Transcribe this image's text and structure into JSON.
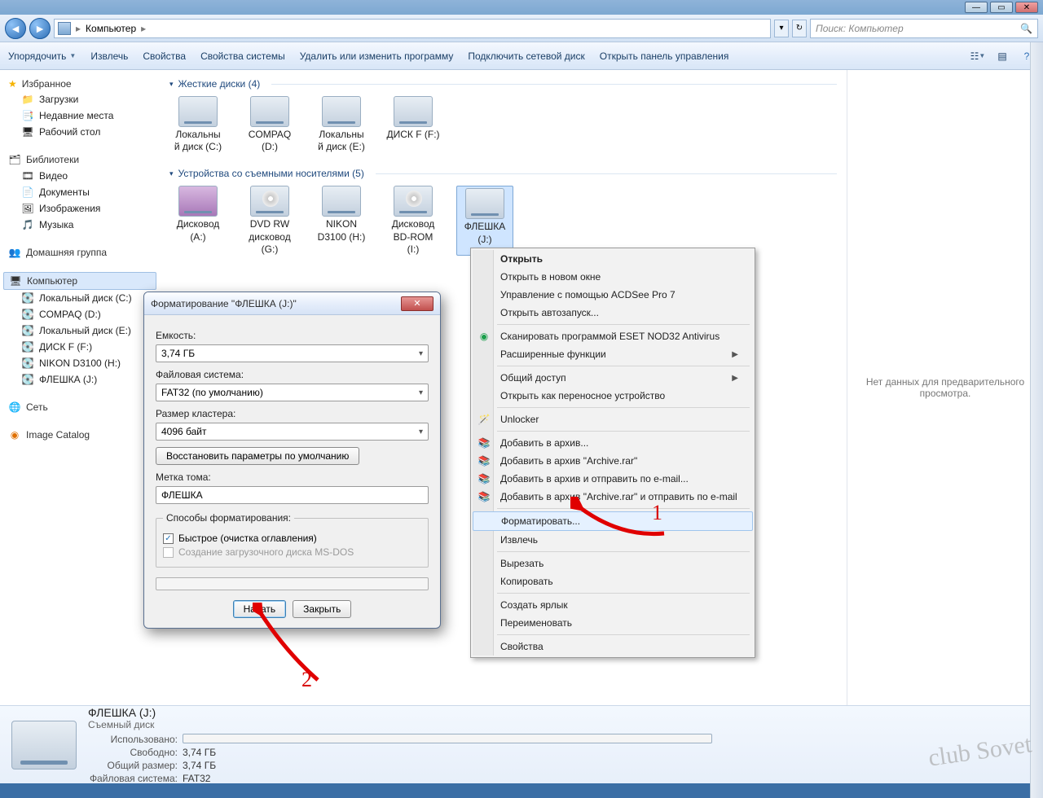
{
  "breadcrumb": {
    "root": "Компьютер",
    "search_placeholder": "Поиск: Компьютер"
  },
  "toolbar": {
    "organize": "Упорядочить",
    "extract": "Извлечь",
    "properties": "Свойства",
    "system_properties": "Свойства системы",
    "remove_change": "Удалить или изменить программу",
    "map_drive": "Подключить сетевой диск",
    "control_panel": "Открыть панель управления"
  },
  "sidebar": {
    "favorites": "Избранное",
    "downloads": "Загрузки",
    "recent": "Недавние места",
    "desktop": "Рабочий стол",
    "libraries": "Библиотеки",
    "videos": "Видео",
    "documents": "Документы",
    "pictures": "Изображения",
    "music": "Музыка",
    "homegroup": "Домашняя группа",
    "computer": "Компьютер",
    "drives": [
      "Локальный диск (C:)",
      "COMPAQ (D:)",
      "Локальный диск (E:)",
      "ДИСК F (F:)",
      "NIKON D3100 (H:)",
      "ФЛЕШКА (J:)"
    ],
    "network": "Сеть",
    "imagecatalog": "Image Catalog"
  },
  "sections": {
    "hdd": "Жесткие диски (4)",
    "removable": "Устройства со съемными носителями (5)"
  },
  "hdd_drives": [
    {
      "l1": "Локальны",
      "l2": "й диск (C:)"
    },
    {
      "l1": "COMPAQ",
      "l2": "(D:)"
    },
    {
      "l1": "Локальны",
      "l2": "й диск (E:)"
    },
    {
      "l1": "ДИСК F (F:)",
      "l2": ""
    }
  ],
  "rem_drives": [
    {
      "l1": "Дисковод",
      "l2": "(A:)"
    },
    {
      "l1": "DVD RW",
      "l2": "дисковод",
      "l3": "(G:)"
    },
    {
      "l1": "NIKON",
      "l2": "D3100 (H:)"
    },
    {
      "l1": "Дисковод",
      "l2": "BD-ROM",
      "l3": "(I:)"
    },
    {
      "l1": "ФЛЕШКА",
      "l2": "(J:)"
    }
  ],
  "preview": {
    "nodata": "Нет данных для предварительного просмотра."
  },
  "context": {
    "open": "Открыть",
    "open_new": "Открыть в новом окне",
    "acdsee": "Управление с помощью ACDSee Pro 7",
    "autorun": "Открыть автозапуск...",
    "eset": "Сканировать программой ESET NOD32 Antivirus",
    "adv": "Расширенные функции",
    "share": "Общий доступ",
    "portable": "Открыть как переносное устройство",
    "unlocker": "Unlocker",
    "addarch": "Добавить в архив...",
    "addarchrar": "Добавить в архив \"Archive.rar\"",
    "addemail": "Добавить в архив и отправить по e-mail...",
    "addraremail": "Добавить в архив \"Archive.rar\" и отправить по e-mail",
    "format": "Форматировать...",
    "eject": "Извлечь",
    "cut": "Вырезать",
    "copy": "Копировать",
    "shortcut": "Создать ярлык",
    "rename": "Переименовать",
    "props": "Свойства"
  },
  "dialog": {
    "title": "Форматирование \"ФЛЕШКА (J:)\"",
    "cap_label": "Емкость:",
    "cap_value": "3,74 ГБ",
    "fs_label": "Файловая система:",
    "fs_value": "FAT32 (по умолчанию)",
    "cluster_label": "Размер кластера:",
    "cluster_value": "4096 байт",
    "restore": "Восстановить параметры по умолчанию",
    "vol_label": "Метка тома:",
    "vol_value": "ФЛЕШКА",
    "method_legend": "Способы форматирования:",
    "quick": "Быстрое (очистка оглавления)",
    "msdos": "Создание загрузочного диска MS-DOS",
    "start": "Начать",
    "close": "Закрыть"
  },
  "status": {
    "title": "ФЛЕШКА (J:)",
    "sub": "Съемный диск",
    "used_lbl": "Использовано:",
    "used_val": "",
    "free_lbl": "Свободно:",
    "free_val": "3,74 ГБ",
    "total_lbl": "Общий размер:",
    "total_val": "3,74 ГБ",
    "fs_lbl": "Файловая система:",
    "fs_val": "FAT32"
  },
  "annot": {
    "one": "1",
    "two": "2"
  },
  "watermark": "club Sovet"
}
